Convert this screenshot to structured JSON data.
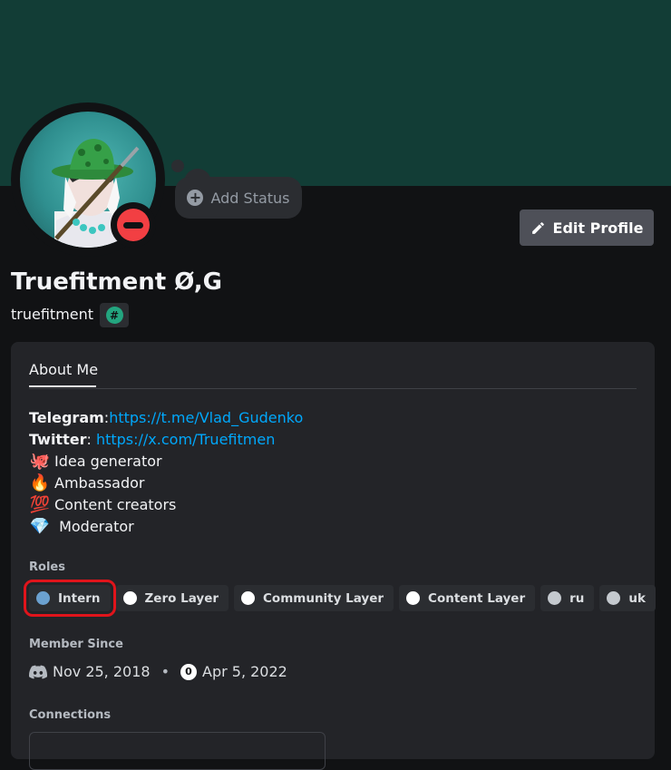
{
  "profile": {
    "display_name": "Truefitment Ø,G",
    "username": "truefitment",
    "add_status_label": "Add Status",
    "edit_profile_label": "Edit Profile",
    "status": "dnd"
  },
  "tabs": [
    {
      "label": "About Me",
      "active": true
    }
  ],
  "bio": {
    "telegram_label": "Telegram",
    "telegram_sep": ":",
    "telegram_url": "https://t.me/Vlad_Gudenko",
    "twitter_label": "Twitter",
    "twitter_sep": ": ",
    "twitter_url": "https://x.com/Truefitmen",
    "lines": [
      {
        "emoji": "🐙",
        "text": "Idea generator"
      },
      {
        "emoji": "🔥",
        "text": "Ambassador"
      },
      {
        "emoji": "💯",
        "text": "Content creators"
      },
      {
        "emoji": "💎",
        "text": " Moderator"
      }
    ]
  },
  "roles": {
    "title": "Roles",
    "items": [
      {
        "label": "Intern",
        "color": "#6ba1d0",
        "highlighted": true
      },
      {
        "label": "Zero Layer",
        "color": "#ffffff"
      },
      {
        "label": "Community Layer",
        "color": "#ffffff"
      },
      {
        "label": "Content Layer",
        "color": "#ffffff"
      },
      {
        "label": "ru",
        "color": "#c4c9ce"
      },
      {
        "label": "uk",
        "color": "#c4c9ce"
      }
    ]
  },
  "member_since": {
    "title": "Member Since",
    "discord_date": "Nov 25, 2018",
    "separator": "•",
    "server_date": "Apr 5, 2022",
    "server_icon_glyph": "0"
  },
  "connections": {
    "title": "Connections"
  },
  "colors": {
    "banner": "#123d36",
    "background": "#111214",
    "card": "#232428",
    "link": "#00a8fc",
    "dnd": "#f23f43",
    "highlight_box": "#e0141b"
  },
  "icons": {
    "add_status": "plus-circle-icon",
    "edit_profile": "pencil-icon",
    "badge": "hash-badge-icon",
    "discord": "discord-logo-icon",
    "status": "do-not-disturb-icon"
  }
}
